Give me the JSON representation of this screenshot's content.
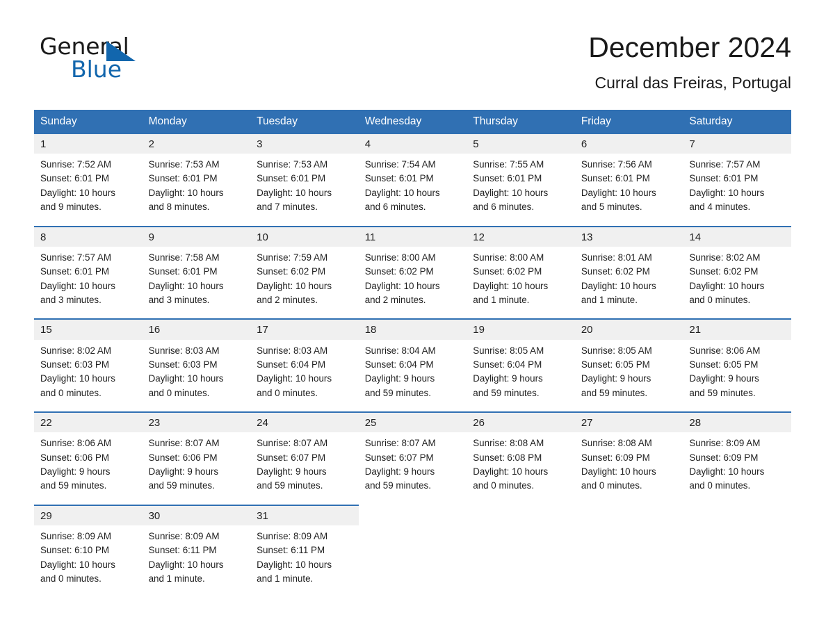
{
  "brand": {
    "name_part1": "General",
    "name_part2": "Blue",
    "triangle_icon": "triangle-icon",
    "accent_color": "#1266ad"
  },
  "header": {
    "title": "December 2024",
    "location": "Curral das Freiras, Portugal",
    "header_bg_color": "#3070b3",
    "daynum_bg_color": "#f0f0f0"
  },
  "weekday_headers": [
    "Sunday",
    "Monday",
    "Tuesday",
    "Wednesday",
    "Thursday",
    "Friday",
    "Saturday"
  ],
  "weeks": [
    [
      {
        "day": "1",
        "sunrise": "Sunrise: 7:52 AM",
        "sunset": "Sunset: 6:01 PM",
        "daylight1": "Daylight: 10 hours",
        "daylight2": "and 9 minutes."
      },
      {
        "day": "2",
        "sunrise": "Sunrise: 7:53 AM",
        "sunset": "Sunset: 6:01 PM",
        "daylight1": "Daylight: 10 hours",
        "daylight2": "and 8 minutes."
      },
      {
        "day": "3",
        "sunrise": "Sunrise: 7:53 AM",
        "sunset": "Sunset: 6:01 PM",
        "daylight1": "Daylight: 10 hours",
        "daylight2": "and 7 minutes."
      },
      {
        "day": "4",
        "sunrise": "Sunrise: 7:54 AM",
        "sunset": "Sunset: 6:01 PM",
        "daylight1": "Daylight: 10 hours",
        "daylight2": "and 6 minutes."
      },
      {
        "day": "5",
        "sunrise": "Sunrise: 7:55 AM",
        "sunset": "Sunset: 6:01 PM",
        "daylight1": "Daylight: 10 hours",
        "daylight2": "and 6 minutes."
      },
      {
        "day": "6",
        "sunrise": "Sunrise: 7:56 AM",
        "sunset": "Sunset: 6:01 PM",
        "daylight1": "Daylight: 10 hours",
        "daylight2": "and 5 minutes."
      },
      {
        "day": "7",
        "sunrise": "Sunrise: 7:57 AM",
        "sunset": "Sunset: 6:01 PM",
        "daylight1": "Daylight: 10 hours",
        "daylight2": "and 4 minutes."
      }
    ],
    [
      {
        "day": "8",
        "sunrise": "Sunrise: 7:57 AM",
        "sunset": "Sunset: 6:01 PM",
        "daylight1": "Daylight: 10 hours",
        "daylight2": "and 3 minutes."
      },
      {
        "day": "9",
        "sunrise": "Sunrise: 7:58 AM",
        "sunset": "Sunset: 6:01 PM",
        "daylight1": "Daylight: 10 hours",
        "daylight2": "and 3 minutes."
      },
      {
        "day": "10",
        "sunrise": "Sunrise: 7:59 AM",
        "sunset": "Sunset: 6:02 PM",
        "daylight1": "Daylight: 10 hours",
        "daylight2": "and 2 minutes."
      },
      {
        "day": "11",
        "sunrise": "Sunrise: 8:00 AM",
        "sunset": "Sunset: 6:02 PM",
        "daylight1": "Daylight: 10 hours",
        "daylight2": "and 2 minutes."
      },
      {
        "day": "12",
        "sunrise": "Sunrise: 8:00 AM",
        "sunset": "Sunset: 6:02 PM",
        "daylight1": "Daylight: 10 hours",
        "daylight2": "and 1 minute."
      },
      {
        "day": "13",
        "sunrise": "Sunrise: 8:01 AM",
        "sunset": "Sunset: 6:02 PM",
        "daylight1": "Daylight: 10 hours",
        "daylight2": "and 1 minute."
      },
      {
        "day": "14",
        "sunrise": "Sunrise: 8:02 AM",
        "sunset": "Sunset: 6:02 PM",
        "daylight1": "Daylight: 10 hours",
        "daylight2": "and 0 minutes."
      }
    ],
    [
      {
        "day": "15",
        "sunrise": "Sunrise: 8:02 AM",
        "sunset": "Sunset: 6:03 PM",
        "daylight1": "Daylight: 10 hours",
        "daylight2": "and 0 minutes."
      },
      {
        "day": "16",
        "sunrise": "Sunrise: 8:03 AM",
        "sunset": "Sunset: 6:03 PM",
        "daylight1": "Daylight: 10 hours",
        "daylight2": "and 0 minutes."
      },
      {
        "day": "17",
        "sunrise": "Sunrise: 8:03 AM",
        "sunset": "Sunset: 6:04 PM",
        "daylight1": "Daylight: 10 hours",
        "daylight2": "and 0 minutes."
      },
      {
        "day": "18",
        "sunrise": "Sunrise: 8:04 AM",
        "sunset": "Sunset: 6:04 PM",
        "daylight1": "Daylight: 9 hours",
        "daylight2": "and 59 minutes."
      },
      {
        "day": "19",
        "sunrise": "Sunrise: 8:05 AM",
        "sunset": "Sunset: 6:04 PM",
        "daylight1": "Daylight: 9 hours",
        "daylight2": "and 59 minutes."
      },
      {
        "day": "20",
        "sunrise": "Sunrise: 8:05 AM",
        "sunset": "Sunset: 6:05 PM",
        "daylight1": "Daylight: 9 hours",
        "daylight2": "and 59 minutes."
      },
      {
        "day": "21",
        "sunrise": "Sunrise: 8:06 AM",
        "sunset": "Sunset: 6:05 PM",
        "daylight1": "Daylight: 9 hours",
        "daylight2": "and 59 minutes."
      }
    ],
    [
      {
        "day": "22",
        "sunrise": "Sunrise: 8:06 AM",
        "sunset": "Sunset: 6:06 PM",
        "daylight1": "Daylight: 9 hours",
        "daylight2": "and 59 minutes."
      },
      {
        "day": "23",
        "sunrise": "Sunrise: 8:07 AM",
        "sunset": "Sunset: 6:06 PM",
        "daylight1": "Daylight: 9 hours",
        "daylight2": "and 59 minutes."
      },
      {
        "day": "24",
        "sunrise": "Sunrise: 8:07 AM",
        "sunset": "Sunset: 6:07 PM",
        "daylight1": "Daylight: 9 hours",
        "daylight2": "and 59 minutes."
      },
      {
        "day": "25",
        "sunrise": "Sunrise: 8:07 AM",
        "sunset": "Sunset: 6:07 PM",
        "daylight1": "Daylight: 9 hours",
        "daylight2": "and 59 minutes."
      },
      {
        "day": "26",
        "sunrise": "Sunrise: 8:08 AM",
        "sunset": "Sunset: 6:08 PM",
        "daylight1": "Daylight: 10 hours",
        "daylight2": "and 0 minutes."
      },
      {
        "day": "27",
        "sunrise": "Sunrise: 8:08 AM",
        "sunset": "Sunset: 6:09 PM",
        "daylight1": "Daylight: 10 hours",
        "daylight2": "and 0 minutes."
      },
      {
        "day": "28",
        "sunrise": "Sunrise: 8:09 AM",
        "sunset": "Sunset: 6:09 PM",
        "daylight1": "Daylight: 10 hours",
        "daylight2": "and 0 minutes."
      }
    ],
    [
      {
        "day": "29",
        "sunrise": "Sunrise: 8:09 AM",
        "sunset": "Sunset: 6:10 PM",
        "daylight1": "Daylight: 10 hours",
        "daylight2": "and 0 minutes."
      },
      {
        "day": "30",
        "sunrise": "Sunrise: 8:09 AM",
        "sunset": "Sunset: 6:11 PM",
        "daylight1": "Daylight: 10 hours",
        "daylight2": "and 1 minute."
      },
      {
        "day": "31",
        "sunrise": "Sunrise: 8:09 AM",
        "sunset": "Sunset: 6:11 PM",
        "daylight1": "Daylight: 10 hours",
        "daylight2": "and 1 minute."
      },
      null,
      null,
      null,
      null
    ]
  ]
}
